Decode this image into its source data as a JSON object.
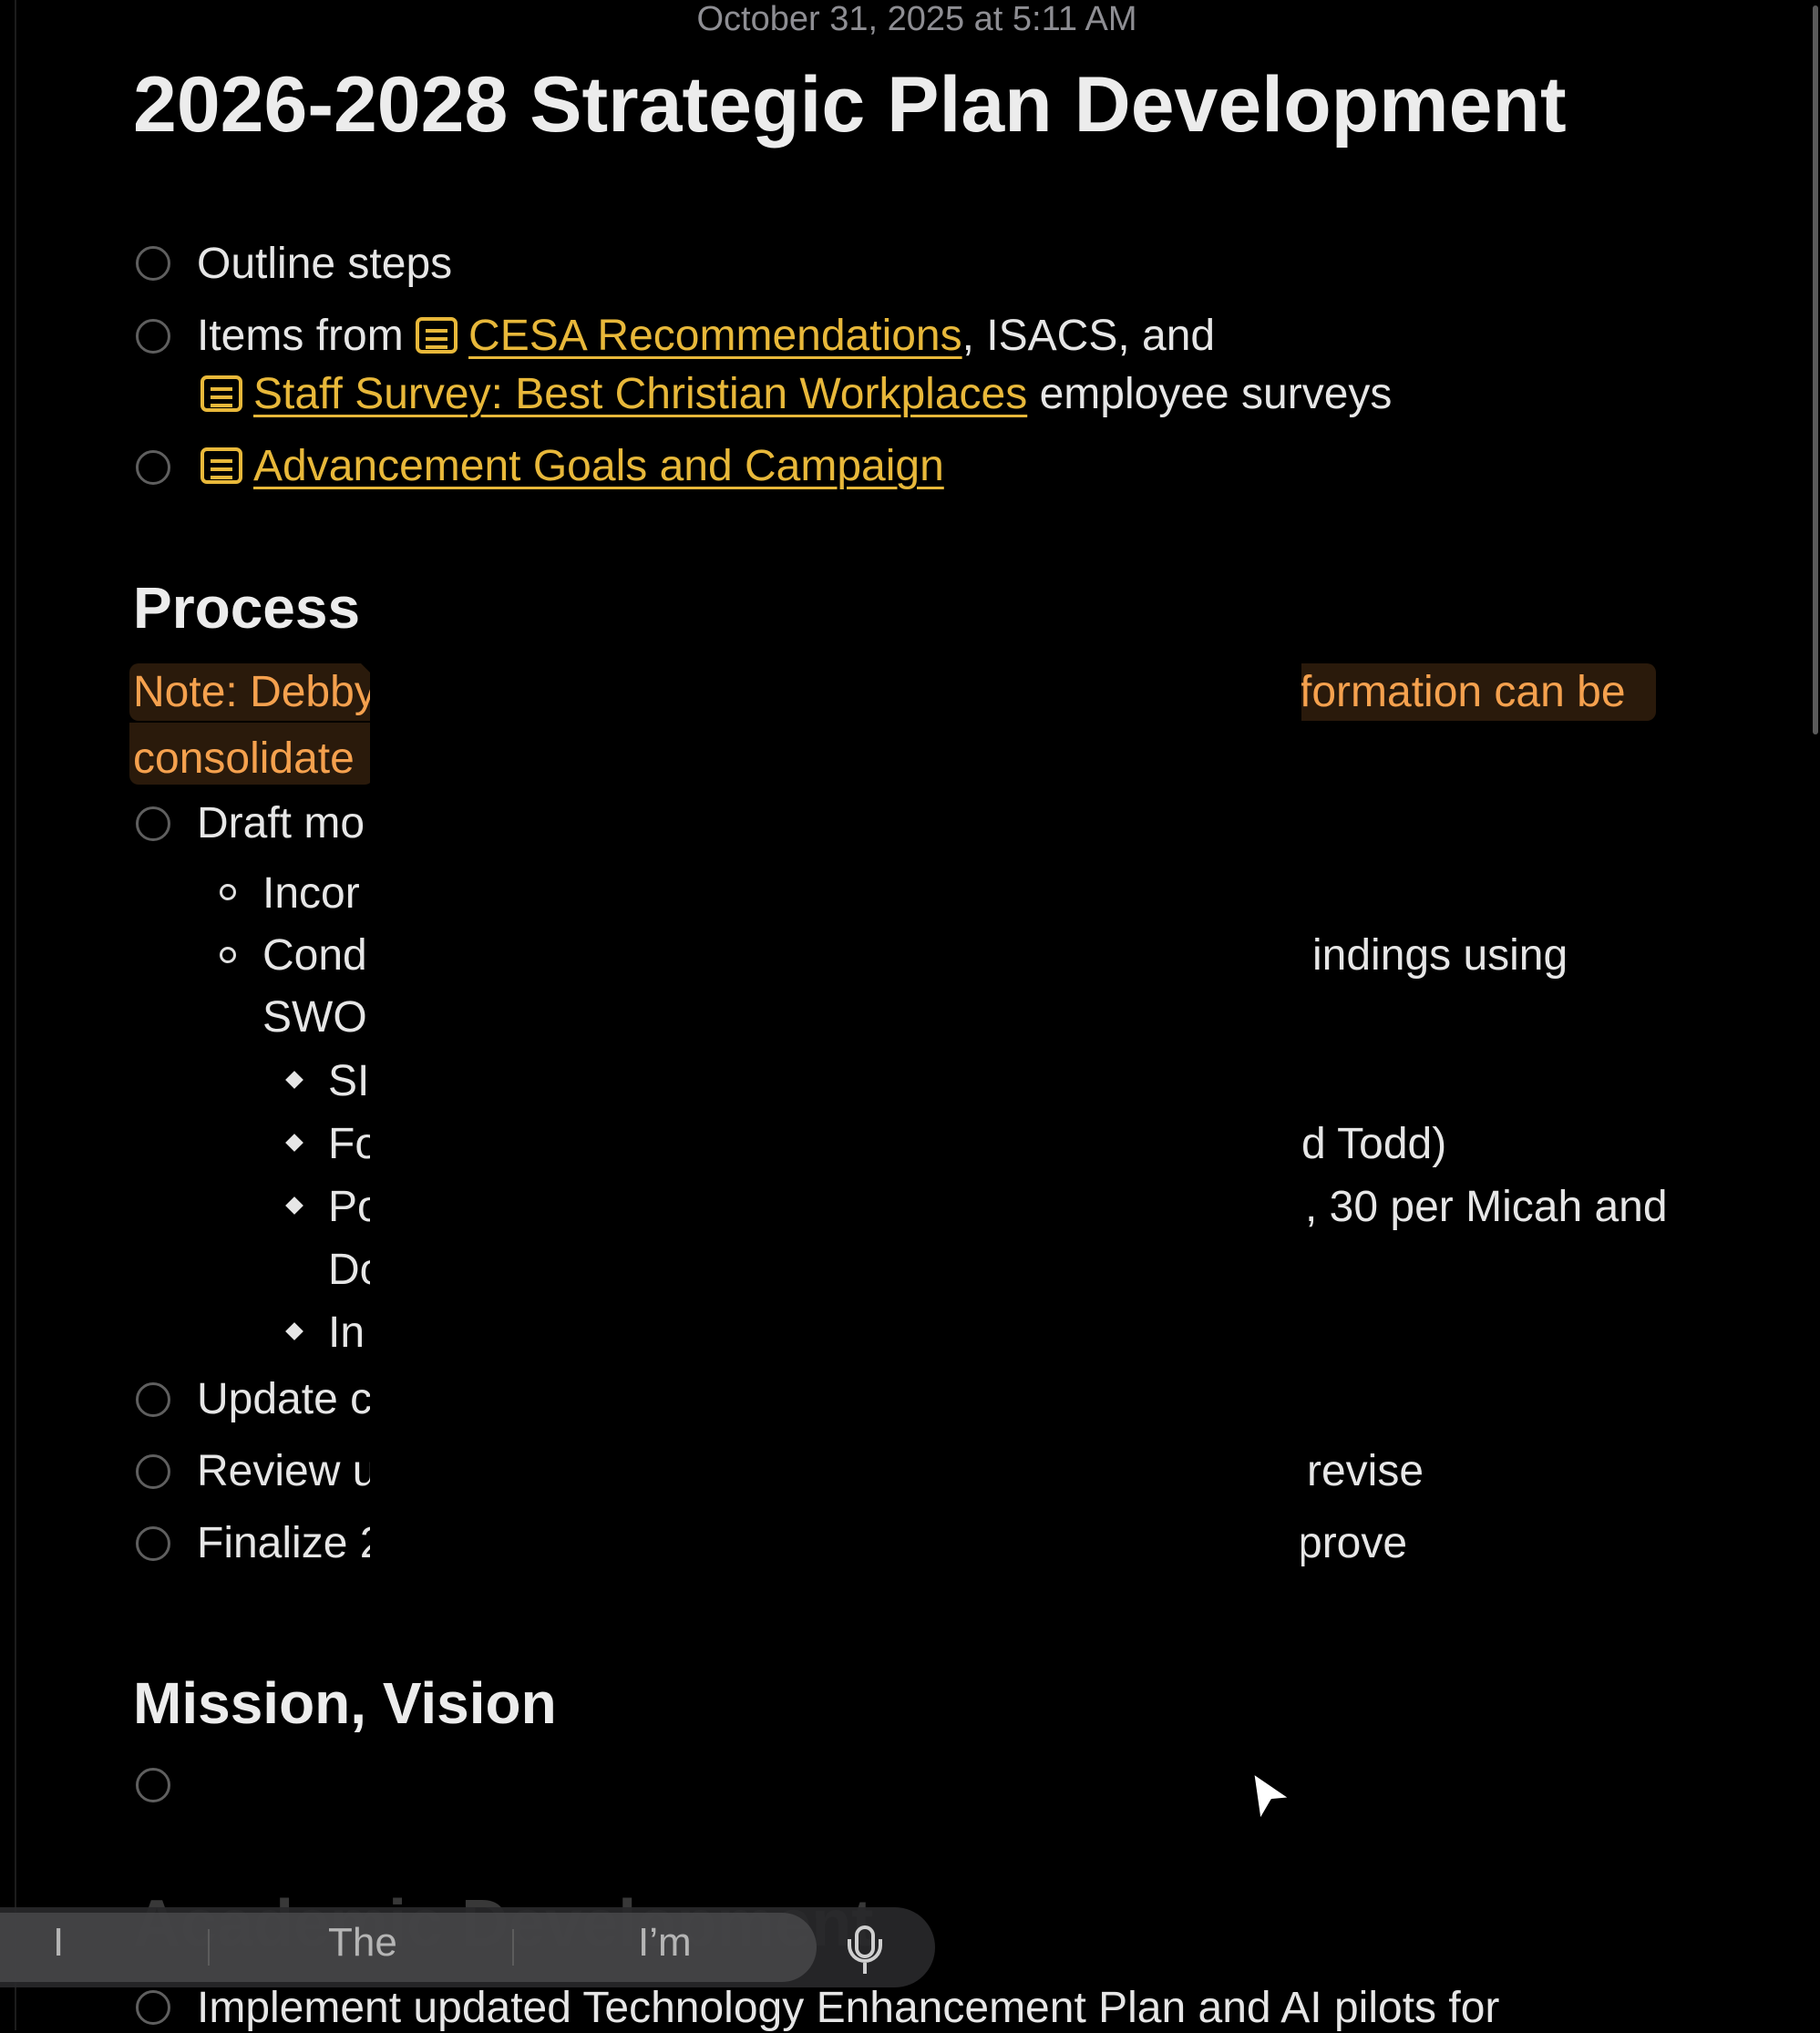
{
  "header": {
    "date": "October 31, 2025 at 5:11 AM",
    "title": "2026-2028 Strategic Plan Development"
  },
  "top_items": {
    "item1": "Outline steps",
    "item2_prefix": "Items from ",
    "item2_link1": "CESA Recommendations",
    "item2_mid": ", ISACS, and",
    "item2_link2": "Staff Survey: Best Christian Workplaces",
    "item2_suffix": " employee surveys",
    "item3_link": "Advancement Goals and Campaign"
  },
  "process": {
    "heading": "Process",
    "note_left": "Note: Debby",
    "note_right": "formation can be",
    "note_line2": "consolidate",
    "rows": {
      "r1": "Draft mo",
      "r2": "Incor",
      "r3_left": "Cond",
      "r3_right": "indings using",
      "r3b": "SWO",
      "r4": "SI",
      "r5_left": "Fo",
      "r5_right": "d Todd)",
      "r6_left": "Po",
      "r6_right": ", 30 per Micah and",
      "r6b": "Do",
      "r7": "In",
      "r8": "Update c",
      "r9_left": "Review u",
      "r9_right": "revise",
      "r10_left": "Finalize 2",
      "r10_right": "prove"
    }
  },
  "mission": {
    "heading": "Mission, Vision"
  },
  "academic": {
    "heading_ghost": "Academic Development",
    "item": "Implement updated Technology Enhancement Plan and AI pilots for"
  },
  "keyboard": {
    "s1": "I",
    "s2": "The",
    "s3": "I’m"
  }
}
